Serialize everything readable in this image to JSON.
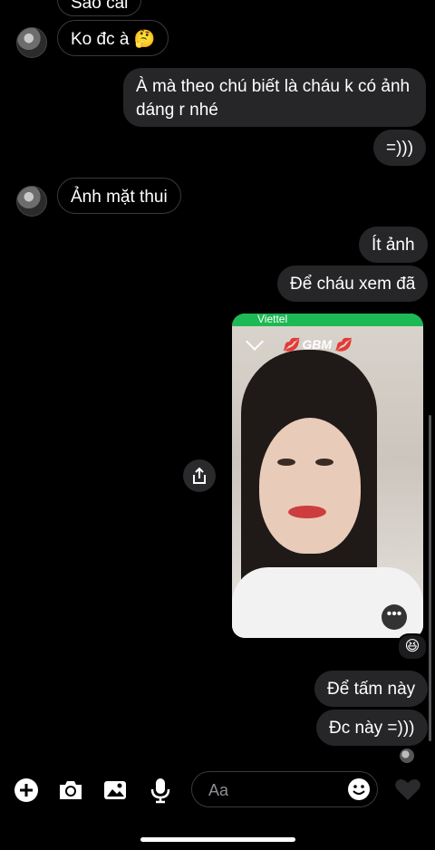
{
  "messages": {
    "partial_top": "Sao cái",
    "m1": "Ko đc à 🤔",
    "m2_line1": "À mà theo chú biết là cháu k có ảnh",
    "m2_line2": "dáng r nhé",
    "m3": "=)))",
    "m4": "Ảnh mặt thui",
    "m5": "Ít ảnh",
    "m6": "Để cháu xem đã",
    "m7": "Để tấm này",
    "m8": "Đc này =)))"
  },
  "photo": {
    "carrier": "Viettel",
    "watermark": "GBM",
    "reaction": "😆",
    "more_icon": "more-dots-icon"
  },
  "composer": {
    "placeholder": "Aa",
    "icons": [
      "plus-icon",
      "camera-icon",
      "gallery-icon",
      "mic-icon",
      "emoji-icon",
      "heart-icon"
    ]
  },
  "colors": {
    "background": "#000000",
    "outgoing_bubble": "#262628",
    "incoming_border": "#3a3a3c",
    "status_green": "#1db954"
  }
}
